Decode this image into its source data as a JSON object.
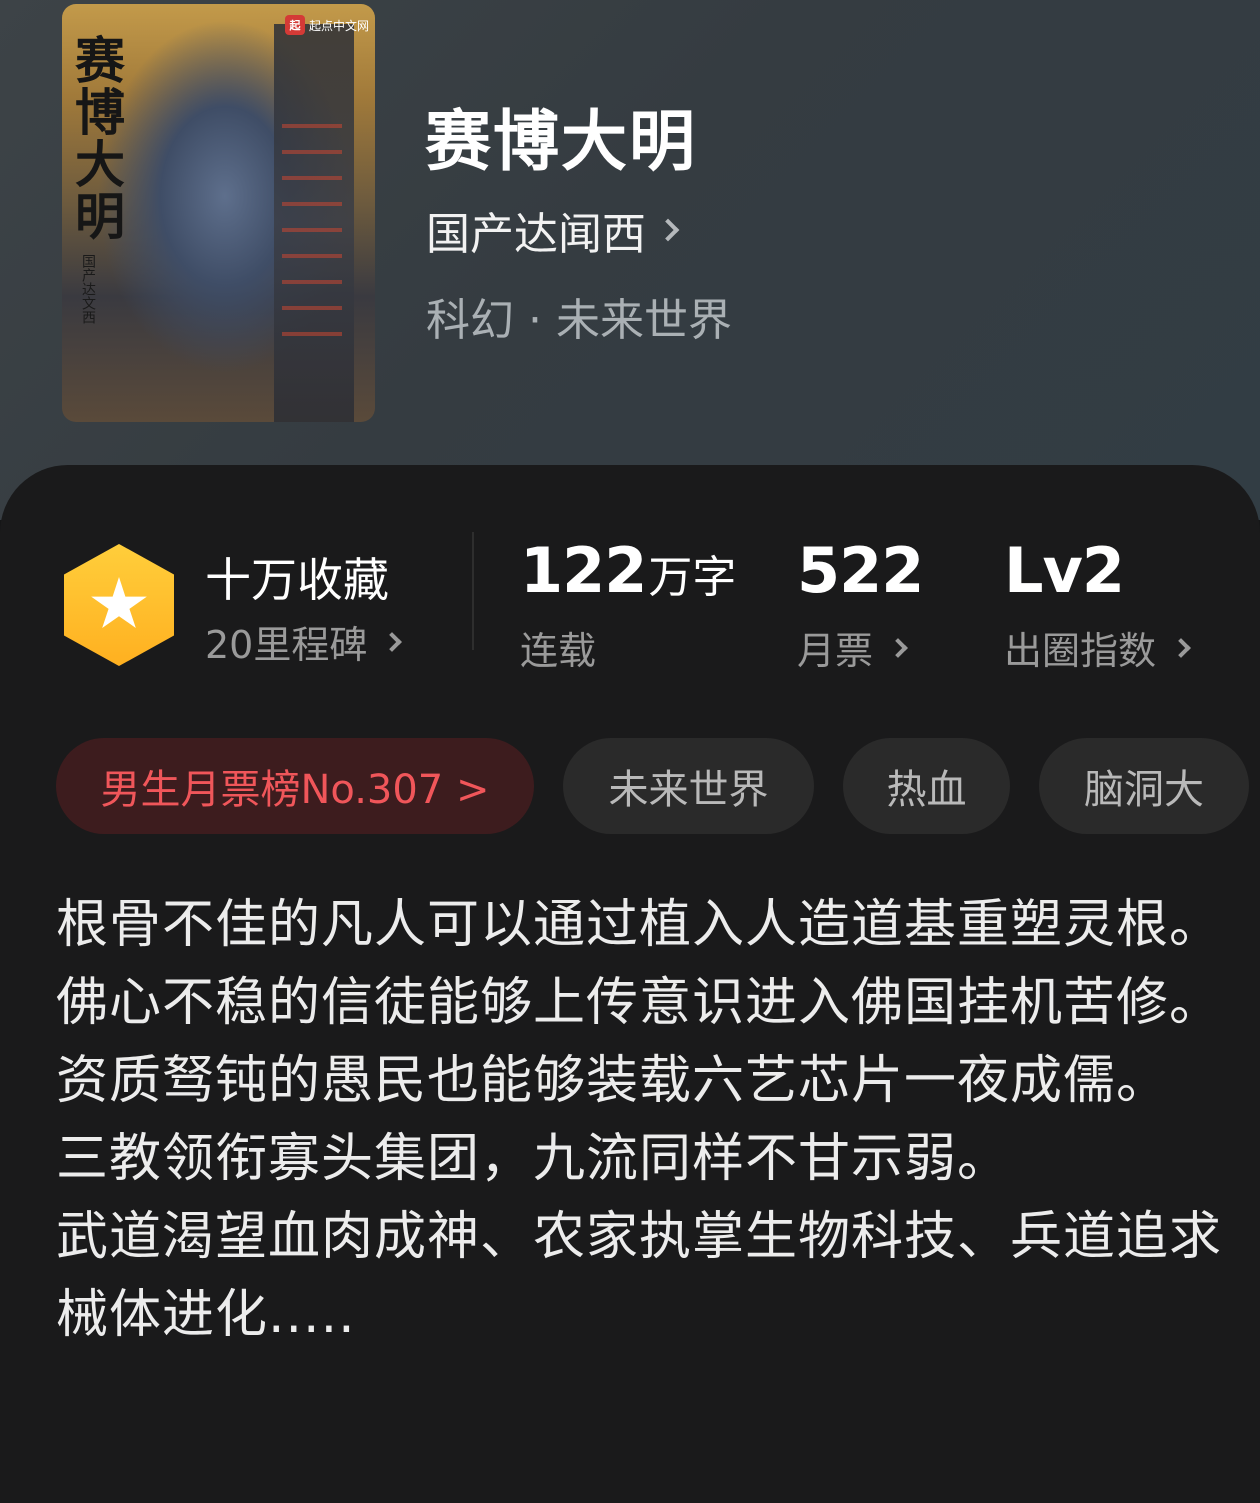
{
  "book": {
    "cover_badge": "起点中文网",
    "cover_badge_logo": "起",
    "cover_title": "赛博大明",
    "cover_author": "国产达文西",
    "title": "赛博大明",
    "author": "国产达闻西",
    "category": "科幻 · 未来世界"
  },
  "stats": {
    "collect_title": "十万收藏",
    "collect_sub": "20里程碑",
    "words_num": "122",
    "words_unit": "万字",
    "words_status": "连载",
    "tickets_num": "522",
    "tickets_label": "月票",
    "level_num": "Lv2",
    "level_label": "出圈指数"
  },
  "tags": {
    "rank": "男生月票榜No.307 >",
    "t1": "未来世界",
    "t2": "热血",
    "t3": "脑洞大"
  },
  "description": [
    "根骨不佳的凡人可以通过植入人造道基重塑灵根。",
    "佛心不稳的信徒能够上传意识进入佛国挂机苦修。",
    "资质驽钝的愚民也能够装载六艺芯片一夜成儒。",
    "三教领衔寡头集团，九流同样不甘示弱。",
    "武道渴望血肉成神、农家执掌生物科技、兵道追求械体进化....."
  ],
  "colors": {
    "accent_rank": "#f0565a",
    "badge": "#ffb020",
    "card_bg": "#1a1a1b"
  },
  "icons": {
    "milestone": "star-hexagon-icon",
    "arrow": "chevron-right-icon"
  }
}
